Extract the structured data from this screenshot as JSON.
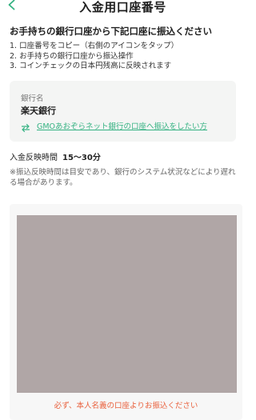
{
  "header": {
    "title": "入金用口座番号",
    "back_icon": "chevron-left-icon",
    "accent_color": "#34b282"
  },
  "instructions": {
    "title": "お手持ちの銀行口座から下記口座に振込ください",
    "steps": [
      "1. 口座番号をコピー（右側のアイコンをタップ）",
      "2. お手持ちの銀行口座から振込操作",
      "3. コインチェックの日本円残高に反映されます"
    ]
  },
  "bank": {
    "label": "銀行名",
    "name": "楽天銀行",
    "switch_icon": "swap-arrows-icon",
    "switch_text": "GMOあおぞらネット銀行の口座へ振込をしたい方"
  },
  "reflect_time": {
    "label": "入金反映時間",
    "value": "15〜30分"
  },
  "note": "※振込反映時間は目安であり、銀行のシステム状況などにより遅れる場合があります。",
  "account": {
    "warning": "必ず、本人名義の口座よりお振込ください",
    "warning_color": "#e9603c"
  }
}
